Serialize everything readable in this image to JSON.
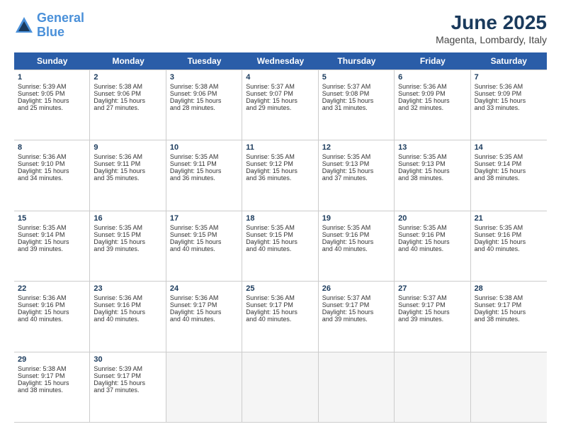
{
  "header": {
    "logo_line1": "General",
    "logo_line2": "Blue",
    "month": "June 2025",
    "location": "Magenta, Lombardy, Italy"
  },
  "weekdays": [
    "Sunday",
    "Monday",
    "Tuesday",
    "Wednesday",
    "Thursday",
    "Friday",
    "Saturday"
  ],
  "rows": [
    [
      {
        "day": "1",
        "lines": [
          "Sunrise: 5:39 AM",
          "Sunset: 9:05 PM",
          "Daylight: 15 hours",
          "and 25 minutes."
        ]
      },
      {
        "day": "2",
        "lines": [
          "Sunrise: 5:38 AM",
          "Sunset: 9:06 PM",
          "Daylight: 15 hours",
          "and 27 minutes."
        ]
      },
      {
        "day": "3",
        "lines": [
          "Sunrise: 5:38 AM",
          "Sunset: 9:06 PM",
          "Daylight: 15 hours",
          "and 28 minutes."
        ]
      },
      {
        "day": "4",
        "lines": [
          "Sunrise: 5:37 AM",
          "Sunset: 9:07 PM",
          "Daylight: 15 hours",
          "and 29 minutes."
        ]
      },
      {
        "day": "5",
        "lines": [
          "Sunrise: 5:37 AM",
          "Sunset: 9:08 PM",
          "Daylight: 15 hours",
          "and 31 minutes."
        ]
      },
      {
        "day": "6",
        "lines": [
          "Sunrise: 5:36 AM",
          "Sunset: 9:09 PM",
          "Daylight: 15 hours",
          "and 32 minutes."
        ]
      },
      {
        "day": "7",
        "lines": [
          "Sunrise: 5:36 AM",
          "Sunset: 9:09 PM",
          "Daylight: 15 hours",
          "and 33 minutes."
        ]
      }
    ],
    [
      {
        "day": "8",
        "lines": [
          "Sunrise: 5:36 AM",
          "Sunset: 9:10 PM",
          "Daylight: 15 hours",
          "and 34 minutes."
        ]
      },
      {
        "day": "9",
        "lines": [
          "Sunrise: 5:36 AM",
          "Sunset: 9:11 PM",
          "Daylight: 15 hours",
          "and 35 minutes."
        ]
      },
      {
        "day": "10",
        "lines": [
          "Sunrise: 5:35 AM",
          "Sunset: 9:11 PM",
          "Daylight: 15 hours",
          "and 36 minutes."
        ]
      },
      {
        "day": "11",
        "lines": [
          "Sunrise: 5:35 AM",
          "Sunset: 9:12 PM",
          "Daylight: 15 hours",
          "and 36 minutes."
        ]
      },
      {
        "day": "12",
        "lines": [
          "Sunrise: 5:35 AM",
          "Sunset: 9:13 PM",
          "Daylight: 15 hours",
          "and 37 minutes."
        ]
      },
      {
        "day": "13",
        "lines": [
          "Sunrise: 5:35 AM",
          "Sunset: 9:13 PM",
          "Daylight: 15 hours",
          "and 38 minutes."
        ]
      },
      {
        "day": "14",
        "lines": [
          "Sunrise: 5:35 AM",
          "Sunset: 9:14 PM",
          "Daylight: 15 hours",
          "and 38 minutes."
        ]
      }
    ],
    [
      {
        "day": "15",
        "lines": [
          "Sunrise: 5:35 AM",
          "Sunset: 9:14 PM",
          "Daylight: 15 hours",
          "and 39 minutes."
        ]
      },
      {
        "day": "16",
        "lines": [
          "Sunrise: 5:35 AM",
          "Sunset: 9:15 PM",
          "Daylight: 15 hours",
          "and 39 minutes."
        ]
      },
      {
        "day": "17",
        "lines": [
          "Sunrise: 5:35 AM",
          "Sunset: 9:15 PM",
          "Daylight: 15 hours",
          "and 40 minutes."
        ]
      },
      {
        "day": "18",
        "lines": [
          "Sunrise: 5:35 AM",
          "Sunset: 9:15 PM",
          "Daylight: 15 hours",
          "and 40 minutes."
        ]
      },
      {
        "day": "19",
        "lines": [
          "Sunrise: 5:35 AM",
          "Sunset: 9:16 PM",
          "Daylight: 15 hours",
          "and 40 minutes."
        ]
      },
      {
        "day": "20",
        "lines": [
          "Sunrise: 5:35 AM",
          "Sunset: 9:16 PM",
          "Daylight: 15 hours",
          "and 40 minutes."
        ]
      },
      {
        "day": "21",
        "lines": [
          "Sunrise: 5:35 AM",
          "Sunset: 9:16 PM",
          "Daylight: 15 hours",
          "and 40 minutes."
        ]
      }
    ],
    [
      {
        "day": "22",
        "lines": [
          "Sunrise: 5:36 AM",
          "Sunset: 9:16 PM",
          "Daylight: 15 hours",
          "and 40 minutes."
        ]
      },
      {
        "day": "23",
        "lines": [
          "Sunrise: 5:36 AM",
          "Sunset: 9:16 PM",
          "Daylight: 15 hours",
          "and 40 minutes."
        ]
      },
      {
        "day": "24",
        "lines": [
          "Sunrise: 5:36 AM",
          "Sunset: 9:17 PM",
          "Daylight: 15 hours",
          "and 40 minutes."
        ]
      },
      {
        "day": "25",
        "lines": [
          "Sunrise: 5:36 AM",
          "Sunset: 9:17 PM",
          "Daylight: 15 hours",
          "and 40 minutes."
        ]
      },
      {
        "day": "26",
        "lines": [
          "Sunrise: 5:37 AM",
          "Sunset: 9:17 PM",
          "Daylight: 15 hours",
          "and 39 minutes."
        ]
      },
      {
        "day": "27",
        "lines": [
          "Sunrise: 5:37 AM",
          "Sunset: 9:17 PM",
          "Daylight: 15 hours",
          "and 39 minutes."
        ]
      },
      {
        "day": "28",
        "lines": [
          "Sunrise: 5:38 AM",
          "Sunset: 9:17 PM",
          "Daylight: 15 hours",
          "and 38 minutes."
        ]
      }
    ],
    [
      {
        "day": "29",
        "lines": [
          "Sunrise: 5:38 AM",
          "Sunset: 9:17 PM",
          "Daylight: 15 hours",
          "and 38 minutes."
        ]
      },
      {
        "day": "30",
        "lines": [
          "Sunrise: 5:39 AM",
          "Sunset: 9:17 PM",
          "Daylight: 15 hours",
          "and 37 minutes."
        ]
      },
      {
        "day": "",
        "lines": []
      },
      {
        "day": "",
        "lines": []
      },
      {
        "day": "",
        "lines": []
      },
      {
        "day": "",
        "lines": []
      },
      {
        "day": "",
        "lines": []
      }
    ]
  ]
}
